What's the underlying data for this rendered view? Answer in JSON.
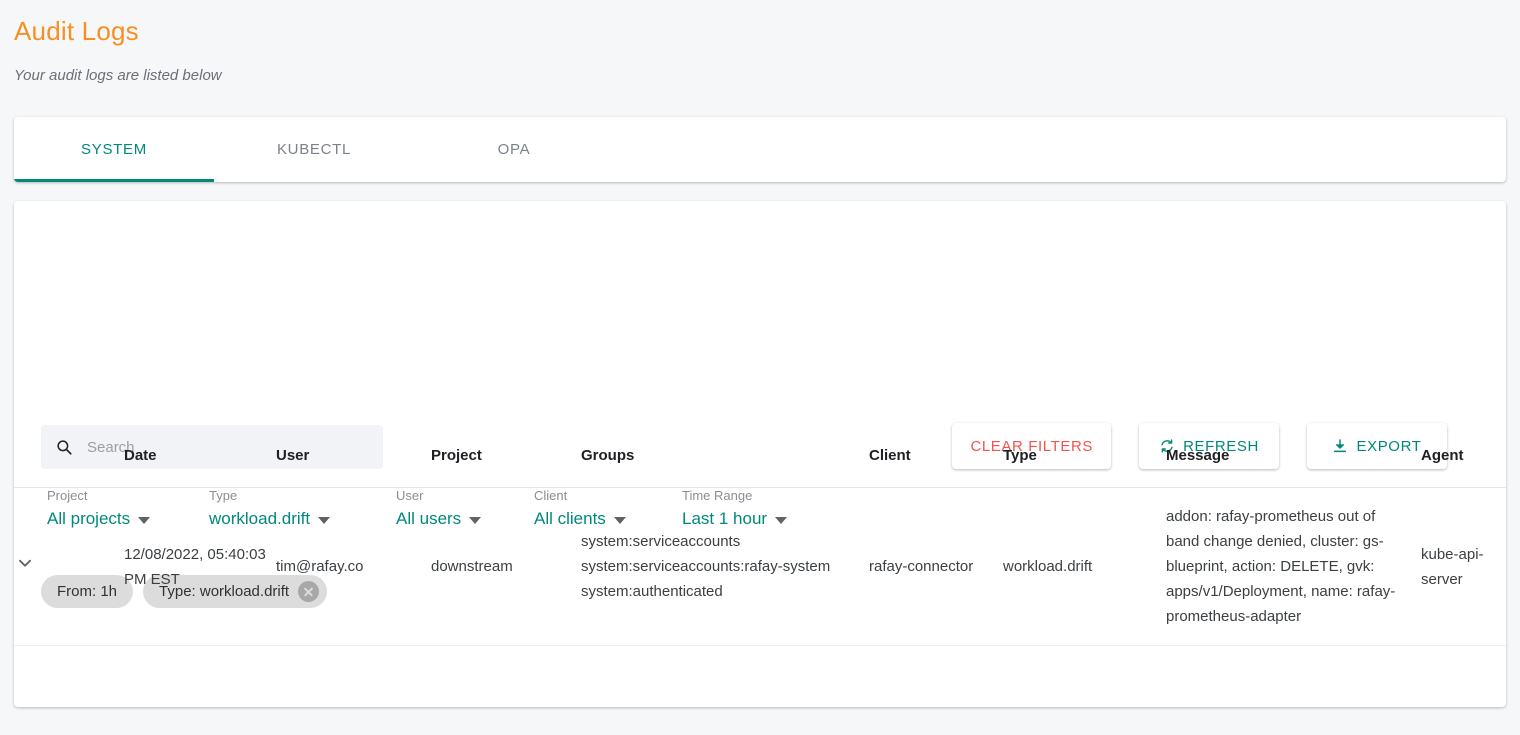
{
  "header": {
    "title": "Audit Logs",
    "subtitle": "Your audit logs are listed below"
  },
  "tabs": [
    {
      "label": "SYSTEM",
      "active": true
    },
    {
      "label": "KUBECTL",
      "active": false
    },
    {
      "label": "OPA",
      "active": false
    }
  ],
  "search": {
    "placeholder": "Search",
    "value": "",
    "icon": "search-icon"
  },
  "actions": [
    {
      "label": "CLEAR FILTERS",
      "icon": "",
      "style": "danger"
    },
    {
      "label": "REFRESH",
      "icon": "refresh-icon",
      "style": "teal"
    },
    {
      "label": "EXPORT",
      "icon": "download-icon",
      "style": "teal"
    }
  ],
  "filters": [
    {
      "label": "Project",
      "value": "All projects"
    },
    {
      "label": "Type",
      "value": "workload.drift"
    },
    {
      "label": "User",
      "value": "All users"
    },
    {
      "label": "Client",
      "value": "All clients"
    },
    {
      "label": "Time Range",
      "value": "Last 1 hour"
    }
  ],
  "chips": [
    {
      "label": "From: 1h",
      "removable": false
    },
    {
      "label": "Type: workload.drift",
      "removable": true
    }
  ],
  "table": {
    "columns": [
      "",
      "Date",
      "User",
      "Project",
      "Groups",
      "Client",
      "Type",
      "Message",
      "Agent"
    ],
    "rows": [
      {
        "expanded": false,
        "date": "12/08/2022, 05:40:03 PM EST",
        "user": "tim@rafay.co",
        "project": "downstream",
        "groups": "system:serviceaccounts\nsystem:serviceaccounts:rafay-system\nsystem:authenticated",
        "client": "rafay-connector",
        "type": "workload.drift",
        "message": "addon: rafay-prometheus out of band change denied, cluster: gs-blueprint, action: DELETE, gvk: apps/v1/Deployment, name: rafay-prometheus-adapter",
        "agent": "kube-api-server"
      }
    ]
  },
  "colors": {
    "title": "#f79021",
    "accent_teal": "#00897b",
    "danger_red": "#f4544b",
    "page_bg": "#f5f7f9",
    "chip_bg": "#dcdcdc"
  }
}
